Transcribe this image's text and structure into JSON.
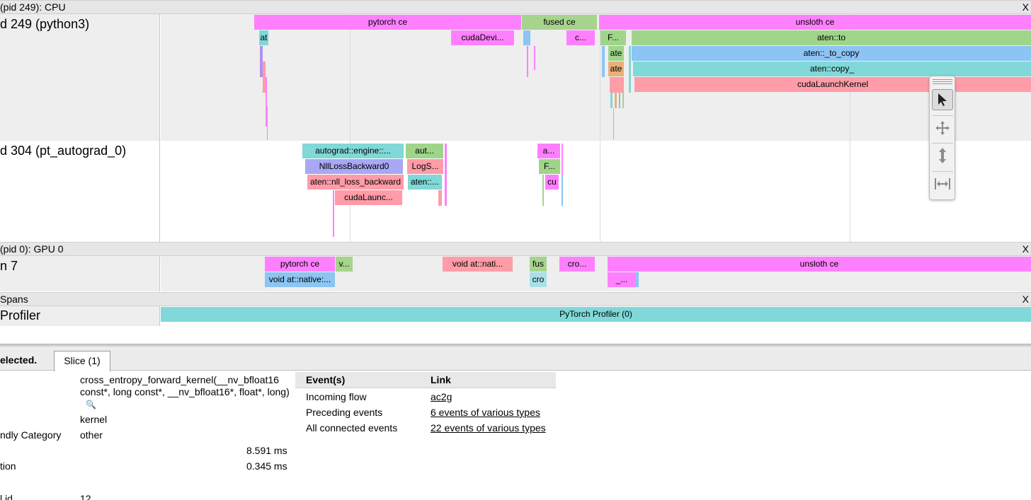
{
  "groups": {
    "cpu": "(pid 249): CPU",
    "gpu": "(pid 0): GPU 0",
    "spans": "Spans"
  },
  "close_label": "X",
  "threads": {
    "python3": "d 249 (python3)",
    "autograd": "d 304 (pt_autograd_0)",
    "gpu_stream": "n 7",
    "profiler": "Profiler"
  },
  "cpu_slices": {
    "pytorch_ce": "pytorch ce",
    "fused_ce": "fused ce",
    "unsloth_ce": "unsloth ce",
    "at": "at",
    "cuda_devi": "cudaDevi...",
    "c_dots": "c...",
    "f_dots": "F...",
    "aten_to": "aten::to",
    "ate1": "ate",
    "aten_to_copy": "aten::_to_copy",
    "ate2": "ate",
    "aten_copy": "aten::copy_",
    "cuda_launch_kernel": "cudaLaunchKernel"
  },
  "autograd_slices": {
    "engine": "autograd::engine::...",
    "aut": "aut...",
    "a_dots": "a...",
    "nll_backward0": "NllLossBackward0",
    "logs": "LogS...",
    "f_dots": "F...",
    "nll_loss_backward": "aten::nll_loss_backward",
    "aten_dots": "aten::...",
    "cu": "cu",
    "cuda_launc": "cudaLaunc..."
  },
  "gpu_slices": {
    "pytorch_ce": "pytorch ce",
    "v_dots": "v...",
    "void_at_nati": "void at::nati...",
    "fus": "fus",
    "cro_dots": "cro...",
    "unsloth_ce": "unsloth ce",
    "void_at_native": "void at::native:...",
    "cro": "cro",
    "underscore_dots": "_..."
  },
  "span_slices": {
    "profiler": "PyTorch Profiler (0)"
  },
  "toolbar": {
    "icons": [
      "grip-icon",
      "select-arrow-icon",
      "pan-icon",
      "zoom-icon",
      "timing-icon"
    ]
  },
  "bottom_panel": {
    "selected_label": "elected.",
    "tab_label": "Slice (1)",
    "properties": {
      "title_value": "cross_entropy_forward_kernel(__nv_bfloat16 const*, long const*, __nv_bfloat16*, float*, long)",
      "category_value": "kernel",
      "friendly_category_key": "ndly Category",
      "friendly_category_value": "other",
      "start_value": "8.591 ms",
      "duration_key": "tion",
      "duration_value": "0.345 ms",
      "id_key": "l id",
      "id_value": "12"
    },
    "events_table": {
      "header_events": "Event(s)",
      "header_link": "Link",
      "rows": [
        {
          "event": "Incoming flow",
          "link": "ac2g"
        },
        {
          "event": "Preceding events",
          "link": "6 events of various types"
        },
        {
          "event": "All connected events",
          "link": "22 events of various types"
        }
      ]
    }
  },
  "colors": {
    "magenta": "#ff80ff",
    "green": "#9fd58a",
    "cyan": "#80d8d8",
    "blue": "#8cc4f4",
    "pink": "#ff9ca8",
    "lavender": "#a8a8f4",
    "orange": "#e8b078",
    "sky": "#8ac8f2"
  }
}
